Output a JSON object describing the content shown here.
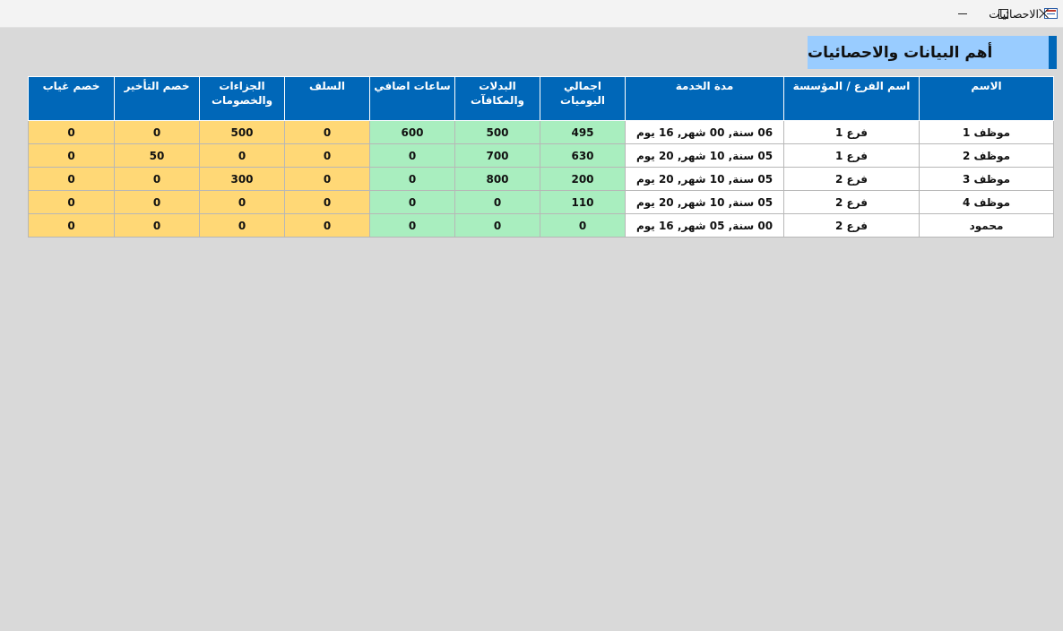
{
  "window": {
    "title": "الاحصائيات"
  },
  "report": {
    "heading": "أهم البيانات والاحصائيات"
  },
  "table": {
    "columns": [
      "الاسم",
      "اسم الفرع / المؤسسة",
      "مدة الخدمة",
      "اجمالي اليوميات",
      "البدلات والمكافآت",
      "ساعات اضافي",
      "السلف",
      "الجزاءات والخصومات",
      "خصم التأخير",
      "خصم غياب"
    ],
    "rows": [
      [
        "موظف 1",
        "فرع 1",
        "06 سنة, 00 شهر, 16 يوم",
        "495",
        "500",
        "600",
        "0",
        "500",
        "0",
        "0"
      ],
      [
        "موظف 2",
        "فرع 1",
        "05 سنة, 10 شهر, 20 يوم",
        "630",
        "700",
        "0",
        "0",
        "0",
        "50",
        "0"
      ],
      [
        "موظف 3",
        "فرع 2",
        "05 سنة, 10 شهر, 20 يوم",
        "200",
        "800",
        "0",
        "0",
        "300",
        "0",
        "0"
      ],
      [
        "موظف 4",
        "فرع 2",
        "05 سنة, 10 شهر, 20 يوم",
        "110",
        "0",
        "0",
        "0",
        "0",
        "0",
        "0"
      ],
      [
        "محمود",
        "فرع 2",
        "00 سنة, 05 شهر, 16 يوم",
        "0",
        "0",
        "0",
        "0",
        "0",
        "0",
        "0"
      ]
    ]
  },
  "colors": {
    "header_bg": "#0067b8",
    "heading_bg": "#99ccff",
    "green_cells": "#a9eebf",
    "orange_cells": "#ffd876",
    "background": "#d9d9d9"
  }
}
